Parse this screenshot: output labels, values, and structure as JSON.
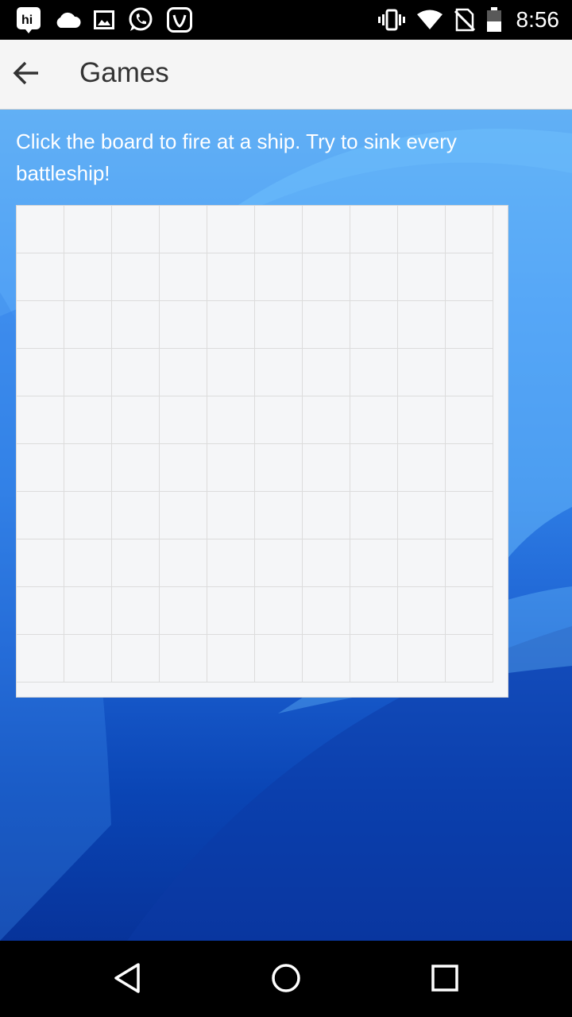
{
  "status_bar": {
    "time": "8:56",
    "left_icons": [
      "hi-app-icon",
      "cloud-icon",
      "image-icon",
      "whatsapp-icon",
      "saavn-icon"
    ],
    "right_icons": [
      "vibrate-icon",
      "wifi-icon",
      "no-sim-icon",
      "battery-icon"
    ]
  },
  "app_bar": {
    "title": "Games"
  },
  "game": {
    "instructions": "Click the board to fire at a ship. Try to sink every battleship!",
    "rows": 10,
    "cols": 10
  },
  "colors": {
    "app_bar_bg": "#f5f5f5",
    "board_bg": "#f5f6f8",
    "grid_line": "#dcdcdc"
  }
}
